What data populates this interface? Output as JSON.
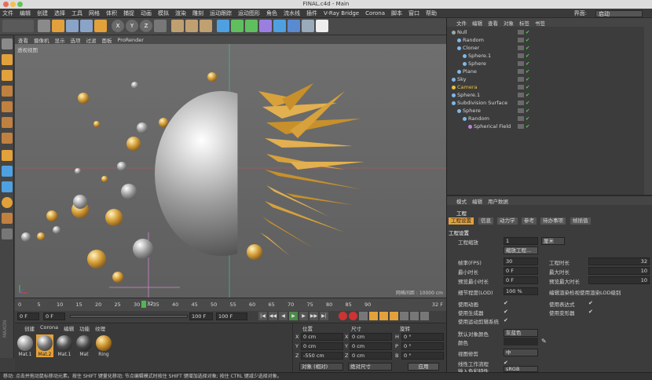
{
  "window": {
    "title": "FINAL.c4d - Main"
  },
  "menubar": {
    "items": [
      "文件",
      "编辑",
      "创建",
      "选择",
      "工具",
      "网格",
      "体积",
      "捕捉",
      "动画",
      "模拟",
      "渲染",
      "雕刻",
      "运动跟踪",
      "运动图形",
      "角色",
      "流水线",
      "插件",
      "V-Ray Bridge",
      "Corona",
      "脚本",
      "窗口",
      "帮助"
    ],
    "layout_label": "界面:",
    "layout_value": "启动"
  },
  "viewport": {
    "menu": [
      "查看",
      "摄像机",
      "显示",
      "选项",
      "过滤",
      "面板",
      "ProRender"
    ],
    "view_name": "透视视图",
    "grid_label": "网格间距 : 10000 cm"
  },
  "timeline": {
    "ticks": [
      "0",
      "5",
      "10",
      "15",
      "20",
      "25",
      "30",
      "35",
      "40",
      "45",
      "50",
      "55",
      "60",
      "65",
      "70",
      "75",
      "80",
      "85",
      "90"
    ],
    "current_frame": "32",
    "end_label": "32 F"
  },
  "transport": {
    "start": "0 F",
    "current": "0 F",
    "end": "100 F",
    "max": "100 F"
  },
  "materials": {
    "menu": [
      "创建",
      "Corona",
      "编辑",
      "功能",
      "纹理"
    ],
    "items": [
      "Mat.1",
      "Mat.2",
      "Mat.1",
      "Mat",
      "Ring"
    ]
  },
  "coords": {
    "headers": [
      "位置",
      "尺寸",
      "旋转"
    ],
    "rows": [
      {
        "axis": "X",
        "pos": "0 cm",
        "size": "0 cm",
        "rot_axis": "H",
        "rot": "0 °"
      },
      {
        "axis": "Y",
        "pos": "0 cm",
        "size": "0 cm",
        "rot_axis": "P",
        "rot": "0 °"
      },
      {
        "axis": "Z",
        "pos": "-550 cm",
        "size": "0 cm",
        "rot_axis": "B",
        "rot": "0 °"
      }
    ],
    "mode": "对象 (相对)",
    "size_mode": "绝对尺寸",
    "apply": "应用"
  },
  "status": {
    "text": "移动: 点击并拖动鼠标移动元素。按住 SHIFT 键量化移动; 节点编辑模式时按住 SHIFT 键增加选择对象; 按住 CTRL 键减少选择对象。"
  },
  "objects": {
    "menu": [
      "文件",
      "编辑",
      "查看",
      "对象",
      "标签",
      "书签"
    ],
    "items": [
      {
        "name": "Null",
        "indent": 0,
        "color": "#9aa"
      },
      {
        "name": "Random",
        "indent": 1,
        "color": "#7fb8e8"
      },
      {
        "name": "Cloner",
        "indent": 1,
        "color": "#7fb8e8"
      },
      {
        "name": "Sphere.1",
        "indent": 2,
        "color": "#7fb8e8"
      },
      {
        "name": "Sphere",
        "indent": 2,
        "color": "#7fb8e8"
      },
      {
        "name": "Plane",
        "indent": 1,
        "color": "#7fb8e8"
      },
      {
        "name": "Sky",
        "indent": 0,
        "color": "#7fb8e8"
      },
      {
        "name": "Camera",
        "indent": 0,
        "color": "#e8c040",
        "highlight": true
      },
      {
        "name": "Sphere.1",
        "indent": 0,
        "color": "#7fb8e8"
      },
      {
        "name": "Subdivision Surface",
        "indent": 0,
        "color": "#7fb8e8"
      },
      {
        "name": "Sphere",
        "indent": 1,
        "color": "#7fb8e8"
      },
      {
        "name": "Random",
        "indent": 2,
        "color": "#7fb8e8"
      },
      {
        "name": "Spherical Field",
        "indent": 3,
        "color": "#c080e0"
      }
    ]
  },
  "attributes": {
    "menu": [
      "模式",
      "编辑",
      "用户数据"
    ],
    "section": "工程",
    "tabs": [
      "工程设置",
      "信息",
      "动力学",
      "参考",
      "待办事项",
      "帧插值"
    ],
    "group": "工程设置",
    "scale_label": "工程缩放",
    "scale_value": "1",
    "scale_unit": "厘米",
    "scale_button": "缩放工程...",
    "fps_label": "帧率(FPS)",
    "fps_value": "30",
    "min_label": "最小时长",
    "min_value": "0 F",
    "preview_min_label": "预览最小时长",
    "preview_min_value": "0 F",
    "project_len_label": "工程时长",
    "project_len_value": "32",
    "max_label": "最大时长",
    "max_value": "10",
    "preview_max_label": "预览最大时长",
    "preview_max_value": "10",
    "lod_label": "细节程度(LOD)",
    "lod_value": "100 %",
    "lod_render": "编辑渲染检视使用渲染LOD级别",
    "use_anim": "使用动画",
    "use_expr": "使用表达式",
    "use_gen": "使用生成器",
    "use_deform": "使用变形器",
    "use_motion": "使用运动剪辑系统",
    "default_color_label": "默认对象颜色",
    "default_color_value": "灰蓝色",
    "color_label": "颜色",
    "view_clip_label": "视图修剪",
    "view_clip_value": "中",
    "linear_label": "线性工作流程",
    "input_color_label": "输入色彩特性",
    "input_color_value": "sRGB"
  }
}
